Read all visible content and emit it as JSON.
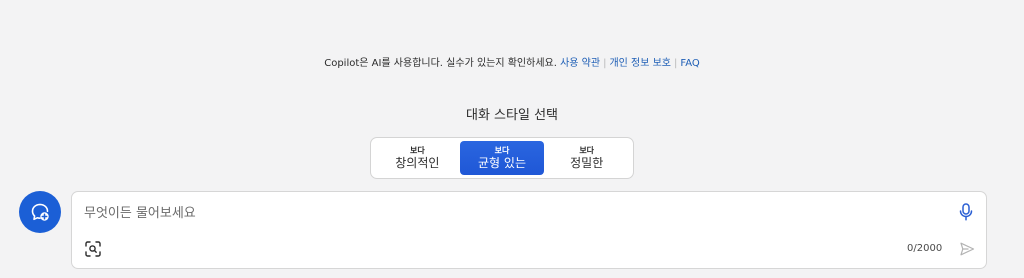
{
  "disclaimer": {
    "text": "Copilot은 AI를 사용합니다. 실수가 있는지 확인하세요.",
    "terms_link": "사용 약관",
    "privacy_link": "개인 정보 보호",
    "faq_link": "FAQ"
  },
  "style_selector": {
    "heading": "대화 스타일 선택",
    "options": [
      {
        "small": "보다",
        "label": "창의적인",
        "selected": false
      },
      {
        "small": "보다",
        "label": "균형 있는",
        "selected": true
      },
      {
        "small": "보다",
        "label": "정밀한",
        "selected": false
      }
    ]
  },
  "chat_input": {
    "placeholder": "무엇이든 물어보세요",
    "value": "",
    "char_count": "0/2000"
  },
  "icons": {
    "new_topic": "new-topic-chat-icon",
    "mic": "microphone-icon",
    "image_search": "image-search-icon",
    "send": "send-icon"
  },
  "colors": {
    "accent": "#1f57d6",
    "link": "#1f5fb6",
    "background": "#f3f3f4"
  }
}
